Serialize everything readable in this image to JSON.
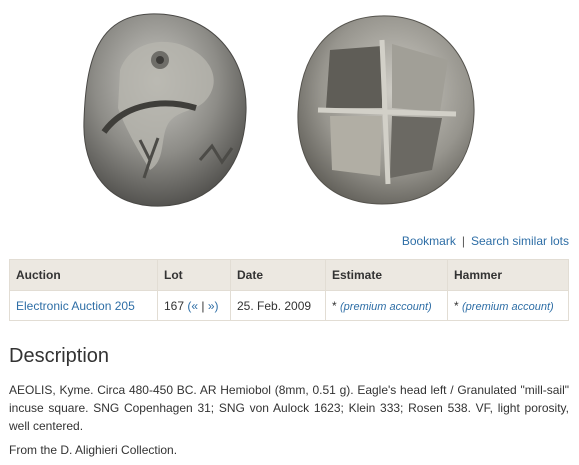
{
  "actions": {
    "bookmark": "Bookmark",
    "separator": "|",
    "search_similar": "Search similar lots"
  },
  "table": {
    "headers": {
      "auction": "Auction",
      "lot": "Lot",
      "date": "Date",
      "estimate": "Estimate",
      "hammer": "Hammer"
    },
    "row": {
      "auction": "Electronic Auction 205",
      "lot_number": "167",
      "lot_prev": "(«",
      "lot_sep": "|",
      "lot_next": "»)",
      "date": "25. Feb. 2009",
      "estimate_prefix": "*",
      "estimate_link": "(premium account)",
      "hammer_prefix": "*",
      "hammer_link": "(premium account)"
    }
  },
  "description": {
    "title": "Description",
    "text": "AEOLIS, Kyme. Circa 480-450 BC. AR Hemiobol (8mm, 0.51 g). Eagle's head left / Granulated \"mill-sail\" incuse square. SNG Copenhagen 31; SNG von Aulock 1623; Klein 333; Rosen 538. VF, light porosity, well centered.",
    "provenance": "From the D. Alighieri Collection."
  },
  "colors": {
    "link": "#2e6ea6",
    "table_header_bg": "#ece8e1",
    "coin_silver": "#9a9a98"
  }
}
